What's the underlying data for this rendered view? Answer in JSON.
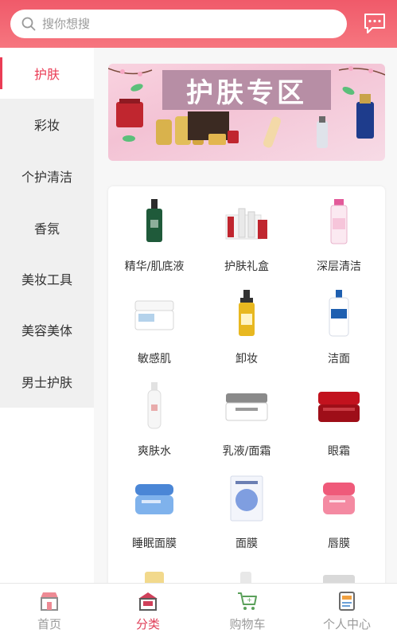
{
  "search": {
    "placeholder": "搜你想搜"
  },
  "header": {
    "message_icon": "chat-bubble-icon"
  },
  "sidebar": {
    "items": [
      {
        "label": "护肤",
        "active": true
      },
      {
        "label": "彩妆",
        "active": false
      },
      {
        "label": "个护清洁",
        "active": false
      },
      {
        "label": "香氛",
        "active": false
      },
      {
        "label": "美妆工具",
        "active": false
      },
      {
        "label": "美容美体",
        "active": false
      },
      {
        "label": "男士护肤",
        "active": false
      }
    ]
  },
  "banner": {
    "title": "护肤专区"
  },
  "grid": {
    "items": [
      {
        "label": "精华/肌底液",
        "icon": "serum-bottle-icon",
        "color": "#1f5a3a"
      },
      {
        "label": "护肤礼盒",
        "icon": "gift-set-icon",
        "color": "#c0262f"
      },
      {
        "label": "深层清洁",
        "icon": "micellar-bottle-icon",
        "color": "#e35a9a"
      },
      {
        "label": "敏感肌",
        "icon": "cream-jar-icon",
        "color": "#6aa6d8"
      },
      {
        "label": "卸妆",
        "icon": "cleansing-oil-icon",
        "color": "#e8b820"
      },
      {
        "label": "洁面",
        "icon": "cleanser-pump-icon",
        "color": "#1e5fb0"
      },
      {
        "label": "爽肤水",
        "icon": "toner-spray-icon",
        "color": "#d7d7d7"
      },
      {
        "label": "乳液/面霜",
        "icon": "face-cream-icon",
        "color": "#8a8a8a"
      },
      {
        "label": "眼霜",
        "icon": "eye-cream-icon",
        "color": "#c2121e"
      },
      {
        "label": "睡眠面膜",
        "icon": "sleeping-mask-jar-icon",
        "color": "#4a86d6"
      },
      {
        "label": "面膜",
        "icon": "sheet-mask-icon",
        "color": "#7f9ee0"
      },
      {
        "label": "唇膜",
        "icon": "lip-mask-jar-icon",
        "color": "#ef5a7a"
      }
    ]
  },
  "tabbar": {
    "items": [
      {
        "label": "首页",
        "icon": "storefront-icon",
        "active": false
      },
      {
        "label": "分类",
        "icon": "category-shop-icon",
        "active": true
      },
      {
        "label": "购物车",
        "icon": "shopping-cart-icon",
        "active": false
      },
      {
        "label": "个人中心",
        "icon": "profile-document-icon",
        "active": false
      }
    ]
  },
  "colors": {
    "accent": "#ea3c55",
    "header": "#f06070"
  }
}
